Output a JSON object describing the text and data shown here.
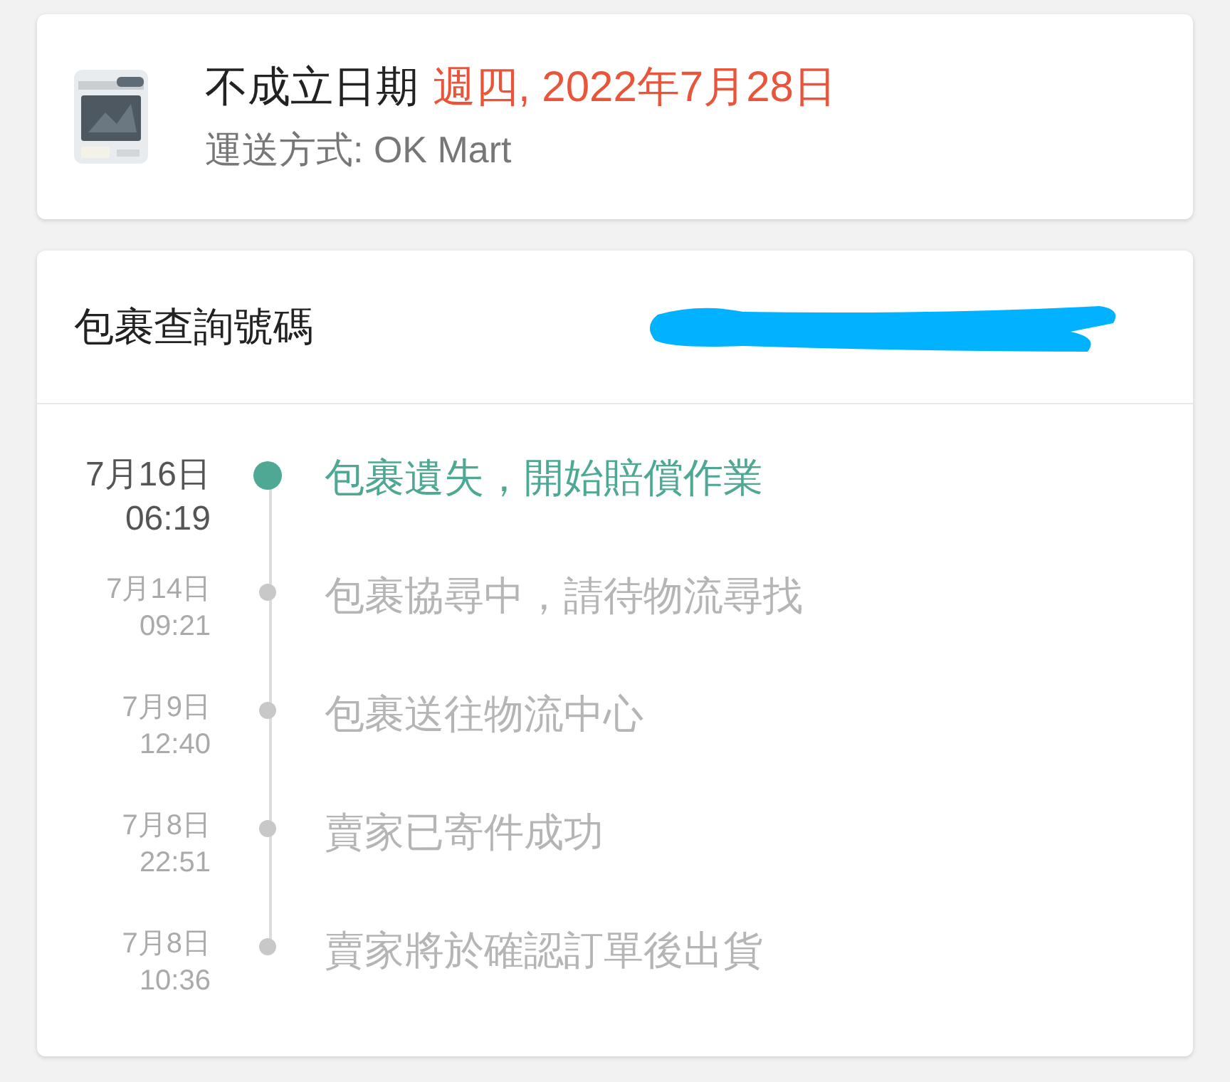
{
  "order": {
    "status_label": "不成立日期",
    "status_date": "週四, 2022年7月28日",
    "shipping": "運送方式: OK Mart"
  },
  "tracking": {
    "label": "包裹查詢號碼",
    "redacted": true
  },
  "timeline": [
    {
      "date": "7月16日",
      "time": "06:19",
      "text": "包裹遺失，開始賠償作業",
      "current": true
    },
    {
      "date": "7月14日",
      "time": "09:21",
      "text": "包裹協尋中，請待物流尋找",
      "current": false
    },
    {
      "date": "7月9日",
      "time": "12:40",
      "text": "包裹送往物流中心",
      "current": false
    },
    {
      "date": "7月8日",
      "time": "22:51",
      "text": "賣家已寄件成功",
      "current": false
    },
    {
      "date": "7月8日",
      "time": "10:36",
      "text": "賣家將於確認訂單後出貨",
      "current": false
    }
  ]
}
